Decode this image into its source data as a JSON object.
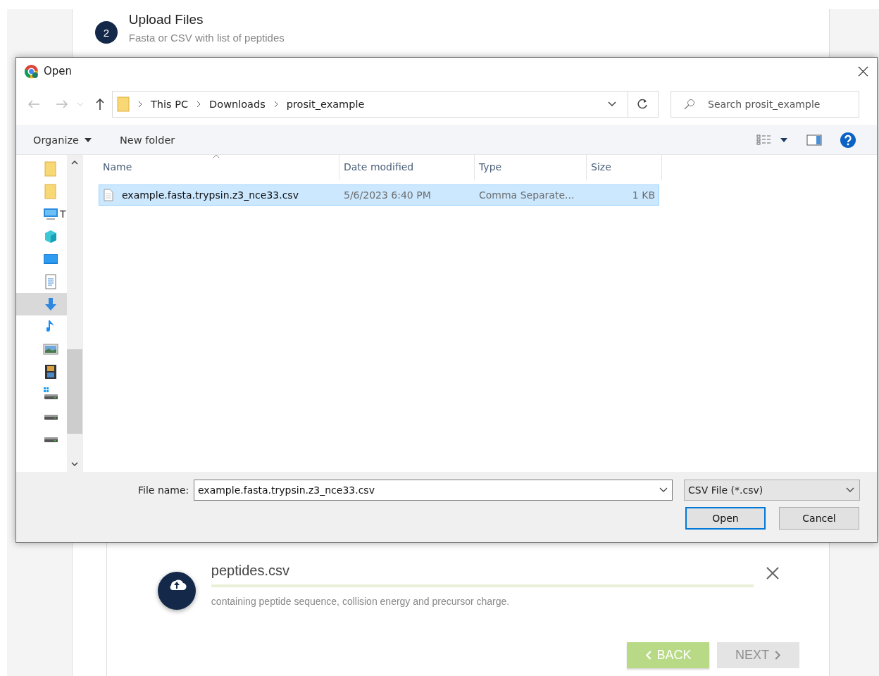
{
  "step": {
    "number": "2",
    "title": "Upload Files",
    "subtitle": "Fasta or CSV with list of peptides"
  },
  "dialog": {
    "title": "Open",
    "breadcrumb": [
      "This PC",
      "Downloads",
      "prosit_example"
    ],
    "search": {
      "placeholder": "Search prosit_example"
    },
    "toolbar": [
      "Organize",
      "New folder"
    ],
    "nav_pane": [
      {
        "kind": "folder",
        "selected": false
      },
      {
        "kind": "folder",
        "selected": false
      },
      {
        "kind": "computer",
        "label": "T",
        "selected": false
      },
      {
        "kind": "cube",
        "selected": false
      },
      {
        "kind": "desktop",
        "selected": false
      },
      {
        "kind": "document",
        "selected": false
      },
      {
        "kind": "download",
        "selected": true
      },
      {
        "kind": "music",
        "selected": false
      },
      {
        "kind": "picture",
        "selected": false
      },
      {
        "kind": "video",
        "selected": false
      },
      {
        "kind": "windrive",
        "selected": false
      },
      {
        "kind": "drive",
        "selected": false
      },
      {
        "kind": "drive",
        "selected": false
      }
    ],
    "columns": [
      "Name",
      "Date modified",
      "Type",
      "Size"
    ],
    "rows": [
      {
        "name": "example.fasta.trypsin.z3_nce33.csv",
        "date": "5/6/2023 6:40 PM",
        "type": "Comma Separate...",
        "size": "1 KB",
        "selected": true
      }
    ],
    "file_name_label": "File name:",
    "file_name": "example.fasta.trypsin.z3_nce33.csv",
    "file_type": "CSV File (*.csv)",
    "buttons": [
      "Open",
      "Cancel"
    ]
  },
  "upload": {
    "file": "peptides.csv",
    "level": 1,
    "description": "containing peptide sequence, collision energy and precursor charge."
  },
  "nav_buttons": [
    {
      "label": "BACK",
      "disabled": false
    },
    {
      "label": "NEXT",
      "disabled": true
    }
  ]
}
